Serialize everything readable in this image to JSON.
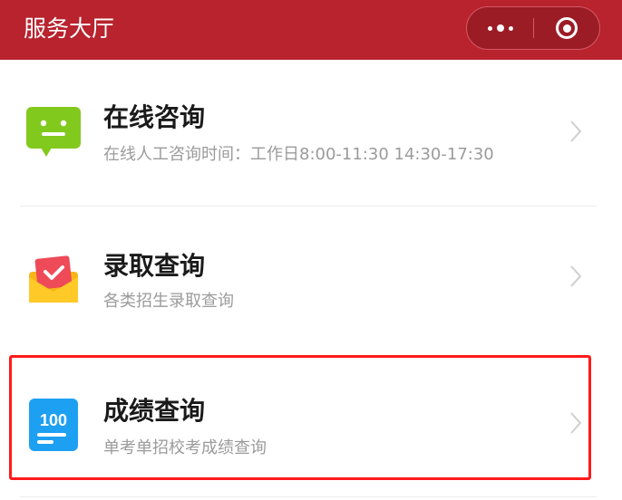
{
  "header": {
    "title": "服务大厅",
    "more_icon": "more-dots-icon",
    "close_icon": "mini-program-close-icon",
    "bg_color": "#b8232e"
  },
  "services": [
    {
      "name": "在线咨询",
      "desc": "在线人工咨询时间：工作日8:00-11:30 14:30-17:30",
      "icon": "chat-bubble-icon"
    },
    {
      "name": "录取查询",
      "desc": "各类招生录取查询",
      "icon": "envelope-check-icon"
    },
    {
      "name": "成绩查询",
      "desc": "单考单招校考成绩查询",
      "icon": "score-100-icon",
      "icon_text": "100",
      "highlighted": true
    }
  ],
  "highlight_color": "#ff1a1a"
}
